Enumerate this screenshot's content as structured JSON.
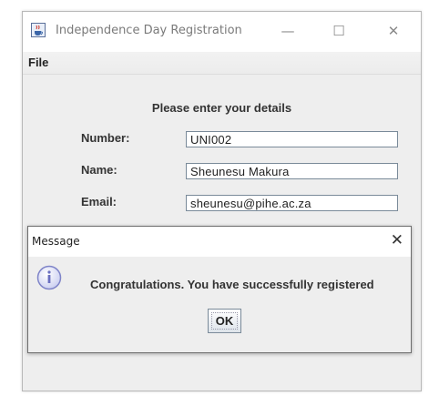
{
  "window": {
    "title": "Independence Day Registration",
    "controls": {
      "minimize": "—",
      "maximize": "☐",
      "close": "✕"
    },
    "icon": "java-cup-icon"
  },
  "menubar": {
    "file": "File"
  },
  "form": {
    "heading": "Please enter your details",
    "number_label": "Number:",
    "number_value": "UNI002",
    "name_label": "Name:",
    "name_value": "Sheunesu Makura",
    "email_label": "Email:",
    "email_value": "sheunesu@pihe.ac.za"
  },
  "dialog": {
    "title": "Message",
    "close": "✕",
    "icon": "info-icon",
    "message": "Congratulations. You have successfully registered",
    "ok_label": "OK"
  },
  "colors": {
    "background": "#eeeeee",
    "field_border": "#7a8a99",
    "info_icon": "#7f84c8"
  }
}
